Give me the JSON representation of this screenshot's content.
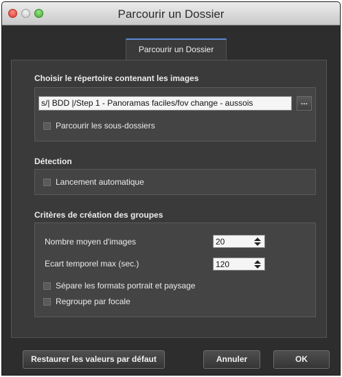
{
  "window": {
    "title": "Parcourir un Dossier"
  },
  "tab": {
    "label": "Parcourir un Dossier"
  },
  "directory_section": {
    "title": "Choisir le répertoire contenant les images",
    "path_value": "s/| BDD |/Step 1 - Panoramas faciles/fov change - aussois",
    "browse_label": "...",
    "subfolders_label": "Parcourir les sous-dossiers",
    "subfolders_checked": false
  },
  "detection_section": {
    "title": "Détection",
    "auto_label": "Lancement automatique",
    "auto_checked": false
  },
  "groups_section": {
    "title": "Critères de création des groupes",
    "avg_images_label": "Nombre moyen d'images",
    "avg_images_value": "20",
    "time_gap_label": "Ecart temporel max (sec.)",
    "time_gap_value": "120",
    "separate_label": "Sépare les formats portrait et paysage",
    "separate_checked": false,
    "focal_label": "Regroupe par focale",
    "focal_checked": false
  },
  "buttons": {
    "restore": "Restaurer les valeurs par défaut",
    "cancel": "Annuler",
    "ok": "OK"
  },
  "colors": {
    "background": "#2d2d2d",
    "panel": "#3a3a3a",
    "group": "#444444",
    "tab_accent": "#5b8ad6"
  }
}
